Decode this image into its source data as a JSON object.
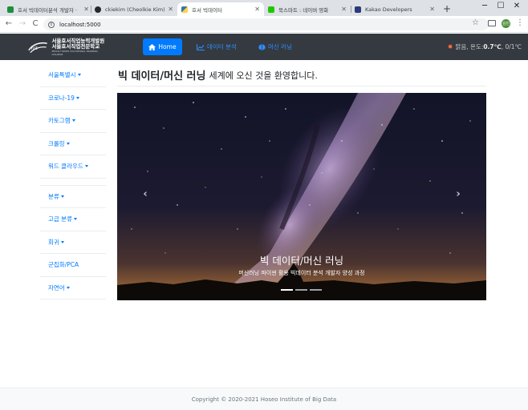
{
  "browser": {
    "tabs": [
      {
        "label": "호서 빅데이터분석 개발자 ·",
        "favicon": "green-sheet-icon",
        "color": "#1e8e3e"
      },
      {
        "label": "ckiekim (Cheolkie Kim)",
        "favicon": "github-icon",
        "color": "#24292e"
      },
      {
        "label": "호서 빅데이터",
        "favicon": "python-icon",
        "color": "#3776ab"
      },
      {
        "label": "북스마트 : 네이버 영화",
        "favicon": "naver-icon",
        "color": "#1ec800"
      },
      {
        "label": "Kakao Developers",
        "favicon": "kakao-icon",
        "color": "#2b3a78"
      }
    ],
    "active_tab_index": 2,
    "new_tab": "+",
    "window_controls": {
      "minimize": "─",
      "maximize": "☐",
      "close": "✕"
    },
    "nav": {
      "back": "←",
      "forward": "→",
      "reload": "C"
    },
    "url": "localhost:5000",
    "info_glyph": "i",
    "star": "☆",
    "profile_initials": "김빈",
    "menu": "⋮"
  },
  "navbar": {
    "logo": {
      "line1": "서울호서직업능력개발원",
      "line2": "서울호서직업전문학교",
      "line3": "SEOUL HOSEO VOCATIONAL TRAINING COLLEGE"
    },
    "home_label": "Home",
    "links": [
      {
        "label": "데이터 분석",
        "icon": "chart-icon",
        "glyph": "⛶"
      },
      {
        "label": "머신 러닝",
        "icon": "brain-icon",
        "glyph": "●"
      }
    ],
    "weather": {
      "prefix": "맑음, 온도: ",
      "temp": "0.7℃",
      "range": ", 0/1℃",
      "icon": "sun-icon"
    }
  },
  "sidebar": {
    "items": [
      {
        "label": "서울특별시",
        "dropdown": true
      },
      {
        "label": "코로나-19",
        "dropdown": true
      },
      {
        "label": "카토그램",
        "dropdown": true
      },
      {
        "label": "크롤링",
        "dropdown": true
      },
      {
        "label": "워드 클라우드",
        "dropdown": true
      },
      {
        "label": "분류",
        "dropdown": true
      },
      {
        "label": "고급 분류",
        "dropdown": true
      },
      {
        "label": "회귀",
        "dropdown": true
      },
      {
        "label": "군집화/PCA",
        "dropdown": false
      },
      {
        "label": "자연어",
        "dropdown": true
      }
    ]
  },
  "main": {
    "heading_strong": "빅 데이터/머신 러닝",
    "heading_rest": "세계에 오신 것을 환영합니다.",
    "carousel": {
      "title": "빅 데이터/머신 러닝",
      "subtitle": "머신러닝 파이썬 활용 빅데이터 분석 개발자 양성 과정",
      "prev": "‹",
      "next": "›",
      "slide_count": 3,
      "active_slide": 0
    }
  },
  "footer": {
    "text": "Copyright © 2020-2021 Hoseo Institute of Big Data"
  }
}
